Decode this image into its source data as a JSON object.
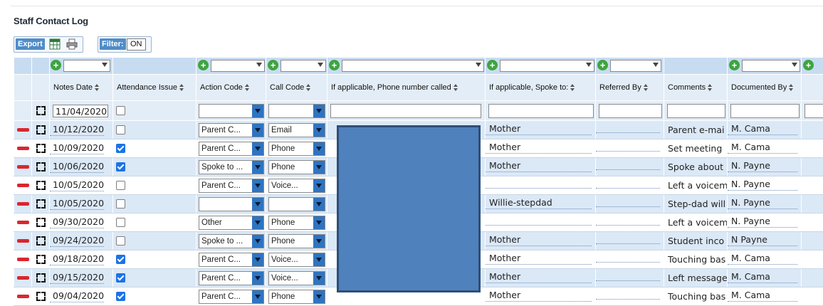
{
  "title": "Staff Contact Log",
  "toolbar": {
    "export_label": "Export",
    "filter_label": "Filter:",
    "filter_state": "ON"
  },
  "columns": [
    "Notes Date",
    "Attendance Issue",
    "Action Code",
    "Call Code",
    "If applicable, Phone number called",
    "If applicable, Spoke to:",
    "Referred By",
    "Comments",
    "Documented By"
  ],
  "new_row": {
    "notes_date": "11/04/2020"
  },
  "rows": [
    {
      "date": "10/12/2020",
      "attendance": false,
      "action": "Parent C...",
      "call": "Email",
      "spoke_to": "Mother",
      "comments": "Parent e-mai",
      "documented_by": "M. Cama"
    },
    {
      "date": "10/09/2020",
      "attendance": true,
      "action": "Parent C...",
      "call": "Phone",
      "spoke_to": "Mother",
      "comments": "Set meeting",
      "documented_by": "M. Cama"
    },
    {
      "date": "10/06/2020",
      "attendance": true,
      "action": "Spoke to ...",
      "call": "Phone",
      "spoke_to": "Mother",
      "comments": "Spoke about",
      "documented_by": "N. Payne"
    },
    {
      "date": "10/05/2020",
      "attendance": false,
      "action": "Parent C...",
      "call": "Voice...",
      "spoke_to": "",
      "comments": "Left a voicem",
      "documented_by": "N. Payne"
    },
    {
      "date": "10/05/2020",
      "attendance": false,
      "action": "",
      "call": "",
      "spoke_to": "Willie-stepdad",
      "comments": "Step-dad will",
      "documented_by": "N. Payne"
    },
    {
      "date": "09/30/2020",
      "attendance": false,
      "action": "Other",
      "call": "Phone",
      "spoke_to": "",
      "comments": "Left a voicem",
      "documented_by": "N. Payne"
    },
    {
      "date": "09/24/2020",
      "attendance": false,
      "action": "Spoke to ...",
      "call": "Phone",
      "spoke_to": "Mother",
      "comments": "Student inco",
      "documented_by": "N Payne"
    },
    {
      "date": "09/18/2020",
      "attendance": true,
      "action": "Parent C...",
      "call": "Voice...",
      "spoke_to": "Mother",
      "comments": "Touching bas",
      "documented_by": "M. Cama"
    },
    {
      "date": "09/15/2020",
      "attendance": true,
      "action": "Parent C...",
      "call": "Voice...",
      "spoke_to": "Mother",
      "comments": "Left message",
      "documented_by": "M. Cama"
    },
    {
      "date": "09/04/2020",
      "attendance": true,
      "action": "Parent C...",
      "call": "Phone",
      "spoke_to": "Mother",
      "comments": "Touching bas",
      "documented_by": "M. Cama"
    }
  ],
  "colors": {
    "row_alt": "#dbe8f6",
    "header": "#e3edf7",
    "filter_bar": "#c8dcf1",
    "delete": "#d9272e",
    "add": "#3fa43f",
    "redaction": "#4f81bd"
  },
  "icons": {
    "export_excel": "excel-icon",
    "print": "print-icon",
    "add": "plus-circle-icon",
    "delete": "minus-icon",
    "expand": "expand-icon"
  }
}
